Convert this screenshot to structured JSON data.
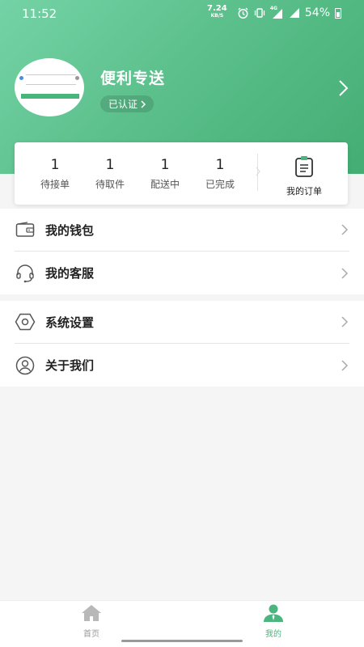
{
  "status_bar": {
    "time": "11:52",
    "net_speed_value": "7.24",
    "net_speed_unit": "KB/S",
    "network_label": "4G",
    "battery_percent": "54%"
  },
  "profile": {
    "name": "便利专送",
    "verify_badge": "已认证"
  },
  "order_stats": [
    {
      "count": "1",
      "label": "待接单"
    },
    {
      "count": "1",
      "label": "待取件"
    },
    {
      "count": "1",
      "label": "配送中"
    },
    {
      "count": "1",
      "label": "已完成"
    }
  ],
  "my_orders_label": "我的订单",
  "menu": {
    "wallet": "我的钱包",
    "service": "我的客服",
    "settings": "系统设置",
    "about": "关于我们"
  },
  "bottom_nav": {
    "home": "首页",
    "mine": "我的",
    "active": "mine"
  },
  "colors": {
    "brand": "#4cb57e",
    "header_light": "#74d3a6",
    "header_dark": "#43ad73"
  }
}
